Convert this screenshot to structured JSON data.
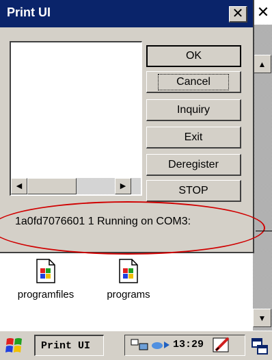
{
  "dialog": {
    "title": "Print UI",
    "close_glyph": "✕"
  },
  "background_window": {
    "close_glyph": "✕",
    "scroll_up_glyph": "▲",
    "scroll_down_glyph": "▼"
  },
  "buttons": {
    "ok": "OK",
    "cancel": "Cancel",
    "inquiry": "Inquiry",
    "exit": "Exit",
    "deregister": "Deregister",
    "stop": "STOP"
  },
  "scrollbar": {
    "left_glyph": "◀",
    "right_glyph": "▶"
  },
  "status_text": "1a0fd7076601 1 Running on COM3:",
  "annotation_color": "#d00000",
  "desktop_icons": [
    {
      "label": "programfiles",
      "icon": "program-file-icon"
    },
    {
      "label": "programs",
      "icon": "program-file-icon"
    }
  ],
  "taskbar": {
    "task_label": "Print UI",
    "clock": "13:29",
    "start_icon": "windows-flag-icon",
    "tray_icons": [
      "network-icon",
      "connection-arrow-icon",
      "pen-input-icon",
      "switch-window-icon"
    ]
  },
  "colors": {
    "titlebar": "#0a246a",
    "face": "#d4d0c8"
  }
}
